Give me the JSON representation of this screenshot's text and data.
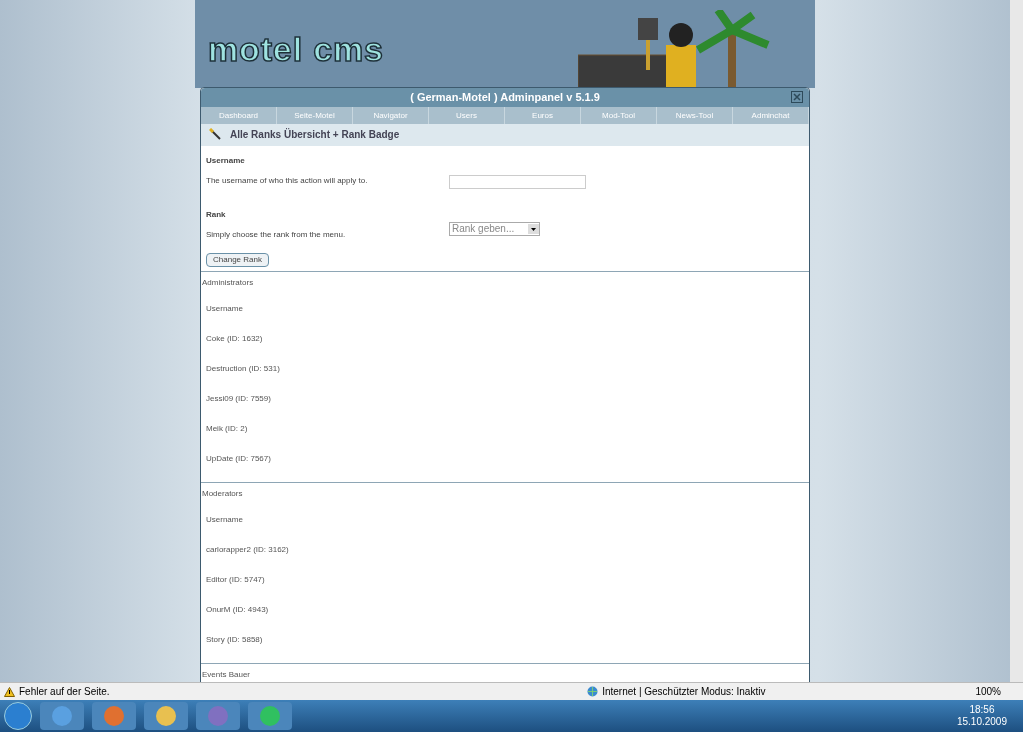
{
  "logo": {
    "text": "motel cms"
  },
  "panel": {
    "title": "( German-Motel ) Adminpanel v 5.1.9",
    "nav": [
      "Dashboard",
      "Seite-Motel",
      "Navigator",
      "Users",
      "Euros",
      "Mod-Tool",
      "News-Tool",
      "Adminchat"
    ],
    "section_title": "Alle Ranks Übersicht + Rank Badge",
    "form": {
      "username_label": "Username",
      "username_hint": "The username of who this action will apply to.",
      "rank_label": "Rank",
      "rank_hint": "Simply choose the rank from the menu.",
      "rank_select": "Rank geben...",
      "submit": "Change Rank"
    },
    "groups": [
      {
        "title": "Administrators",
        "header": "Username",
        "members": [
          "Coke (ID: 1632)",
          "Destruction (ID: 531)",
          "Jessi09 (ID: 7559)",
          "Meik (ID: 2)",
          "UpDate (ID: 7567)"
        ]
      },
      {
        "title": "Moderators",
        "header": "Username",
        "members": [
          "carlorapper2 (ID: 3162)",
          "Editor (ID: 5747)",
          "OnurM (ID: 4943)",
          "Story (ID: 5858)"
        ]
      },
      {
        "title": "Events Bauer"
      }
    ]
  },
  "status_bar": {
    "message": "Fehler auf der Seite.",
    "zone": "Internet | Geschützter Modus: Inaktiv",
    "zoom": "100%"
  },
  "taskbar": {
    "time": "18:56",
    "date": "15.10.2009"
  }
}
